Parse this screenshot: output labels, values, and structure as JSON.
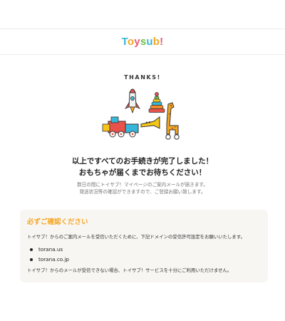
{
  "header": {
    "logo_parts": [
      "T",
      "o",
      "y",
      "s",
      "u",
      "b",
      "!"
    ]
  },
  "hero": {
    "thanks": "THANKS!"
  },
  "main": {
    "title_line1": "以上ですべてのお手続きが完了しました！",
    "title_line2": "おもちゃが届くまでお待ちください！",
    "sub_line1": "数日の間にトイサブ！マイページのご案内メールが届きます。",
    "sub_line2": "発送状況等の確認ができますので、ご登録お願い致します。"
  },
  "notice": {
    "title": "必ずご確認ください",
    "text": "トイサブ！からのご案内メールを受信いただくために、下記ドメインの受信許可設定をお願いいたします。",
    "domains": [
      "torana.us",
      "torana.co.jp"
    ],
    "footer": "トイサブ！からのメールが受信できない場合、トイサブ！サービスを十分にご利用いただけません。"
  },
  "colors": {
    "accent": "#f5a623",
    "notice_bg": "#f8f6f3"
  }
}
